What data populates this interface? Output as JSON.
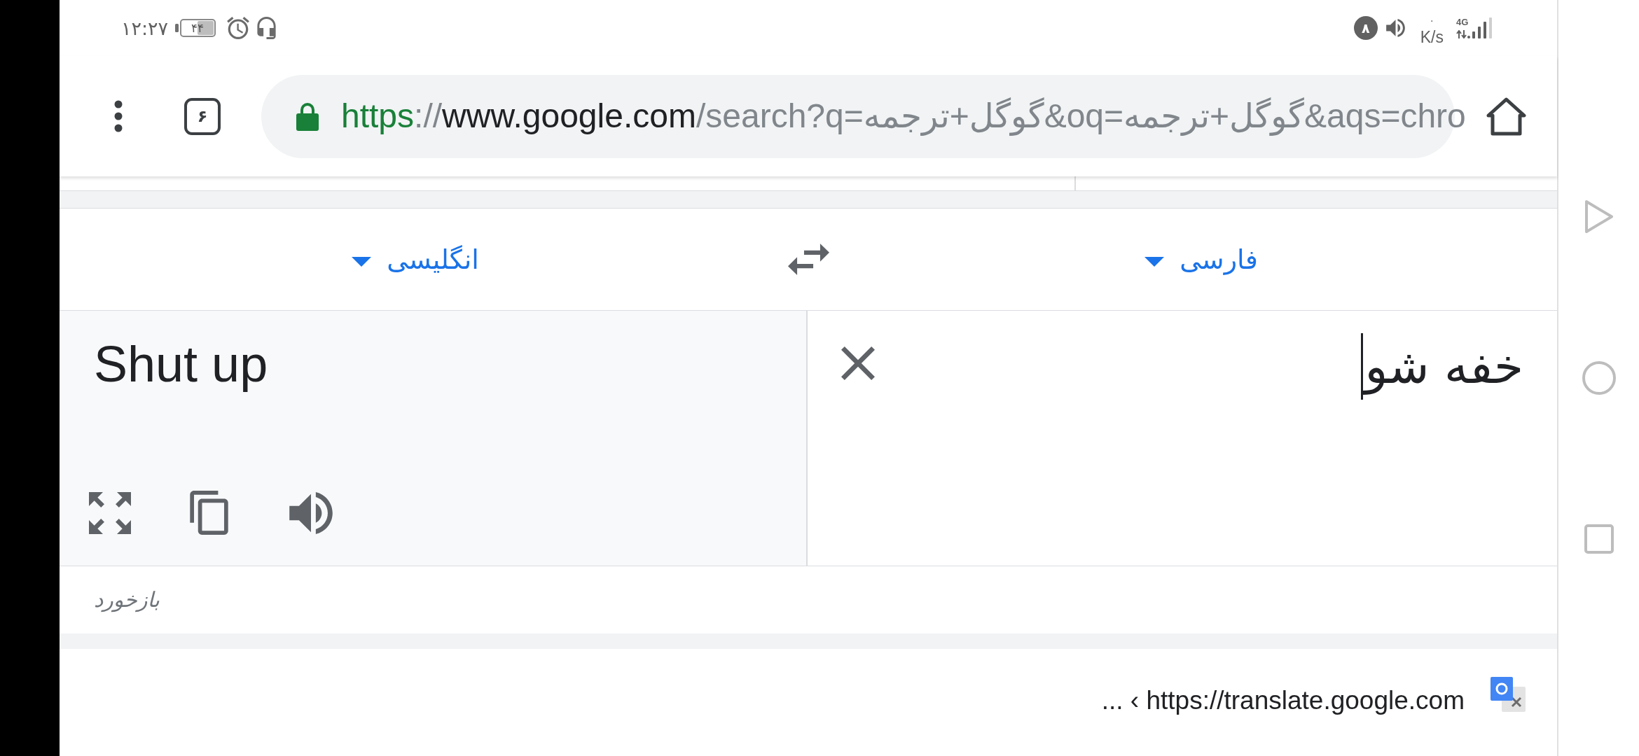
{
  "status_bar": {
    "time": "۱۲:۲۷",
    "battery": "۴۴",
    "notification_count": "۸",
    "speed_value": "۰",
    "speed_unit": "K/s",
    "network_type": "4G"
  },
  "toolbar": {
    "tab_count": "۶",
    "url": {
      "scheme": "https",
      "separator": "://",
      "host": "www.google.com",
      "path": "/search?q=گوگل+ترجمه&oq=گوگل+ترجمه&aqs=chro"
    }
  },
  "translator": {
    "source_language": {
      "label": "فارسی"
    },
    "target_language": {
      "label": "انگلیسی"
    },
    "input": {
      "value": "خفه شو"
    },
    "translation": "Shut up",
    "feedback_link": "بازخورد"
  },
  "result": {
    "url": "... ‹ https://translate.google.com"
  }
}
